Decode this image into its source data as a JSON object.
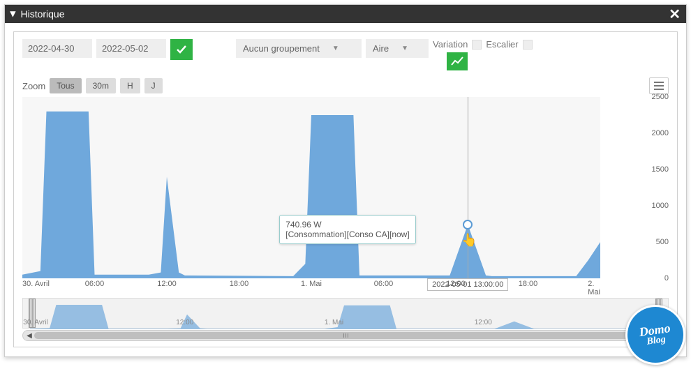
{
  "header": {
    "title": "Historique"
  },
  "toolbar": {
    "date_from": "2022-04-30",
    "date_to": "2022-05-02",
    "grouping_label": "Aucun groupement",
    "charttype_label": "Aire",
    "variation_label": "Variation",
    "stairs_label": "Escalier"
  },
  "zoom": {
    "label": "Zoom",
    "buttons": [
      "Tous",
      "30m",
      "H",
      "J"
    ],
    "active": "Tous"
  },
  "chart_data": {
    "type": "area",
    "series_name": "[Consommation][Conso CA][now]",
    "ylabel": "",
    "xlabel": "",
    "ylim": [
      0,
      2500
    ],
    "yticks": [
      0,
      500,
      1000,
      1500,
      2000,
      2500
    ],
    "xticks": [
      "30. Avril",
      "06:00",
      "12:00",
      "18:00",
      "1. Mai",
      "06:00",
      "12:00",
      "18:00",
      "2. Mai"
    ],
    "x": [
      "2022-04-30 00:00",
      "2022-04-30 01:30",
      "2022-04-30 02:00",
      "2022-04-30 02:30",
      "2022-04-30 05:30",
      "2022-04-30 06:00",
      "2022-04-30 10:30",
      "2022-04-30 11:30",
      "2022-04-30 12:00",
      "2022-04-30 13:00",
      "2022-04-30 13:30",
      "2022-04-30 22:30",
      "2022-04-30 23:30",
      "2022-05-01 00:00",
      "2022-05-01 00:30",
      "2022-05-01 03:30",
      "2022-05-01 04:00",
      "2022-05-01 11:30",
      "2022-05-01 13:00",
      "2022-05-01 14:30",
      "2022-05-01 15:00",
      "2022-05-01 22:00",
      "2022-05-01 23:00",
      "2022-05-02 00:00"
    ],
    "values": [
      50,
      100,
      2300,
      2300,
      2300,
      50,
      50,
      80,
      1400,
      80,
      40,
      30,
      200,
      2250,
      2250,
      2250,
      40,
      40,
      740.96,
      40,
      30,
      30,
      250,
      500
    ],
    "tooltip": {
      "value_text": "740.96 W",
      "series_text": "[Consommation][Conso CA][now]",
      "x_label": "2022-05-01 13:00:00"
    }
  },
  "navigator": {
    "ticks": [
      "30. Avril",
      "12:00",
      "1. Mai",
      "12:00"
    ]
  },
  "logo": {
    "line1": "Domo",
    "line2": "Blog"
  }
}
